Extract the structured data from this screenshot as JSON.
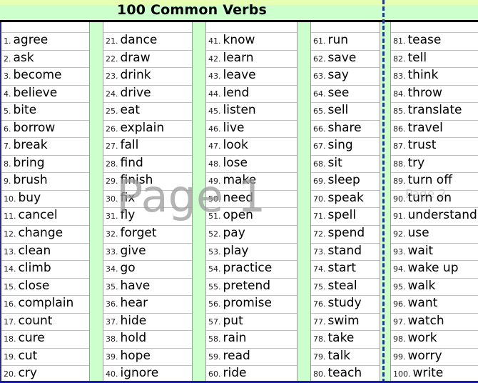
{
  "document": {
    "title": "100 Common Verbs"
  },
  "watermarks": {
    "page1": "Page 1",
    "page2": "Page 2"
  },
  "colors": {
    "title_band": "#ccffcc",
    "title_band_tint": "#e6ffb3",
    "spacer_column": "#ccffcc",
    "grid_line": "#c0c0c0",
    "page_break_line": "#1f3b87",
    "bottom_rule": "#1a1aa8",
    "text": "#000000",
    "watermark": "#9b9b9b"
  },
  "columns": [
    {
      "id": "column-1",
      "range": "1-20",
      "entries": [
        {
          "num": "1.",
          "word": "agree"
        },
        {
          "num": "2.",
          "word": "ask"
        },
        {
          "num": "3.",
          "word": "become"
        },
        {
          "num": "4.",
          "word": "believe"
        },
        {
          "num": "5.",
          "word": "bite"
        },
        {
          "num": "6.",
          "word": "borrow"
        },
        {
          "num": "7.",
          "word": "break"
        },
        {
          "num": "8.",
          "word": "bring"
        },
        {
          "num": "9.",
          "word": "brush"
        },
        {
          "num": "10.",
          "word": "buy"
        },
        {
          "num": "11.",
          "word": "cancel"
        },
        {
          "num": "12.",
          "word": "change"
        },
        {
          "num": "13.",
          "word": "clean"
        },
        {
          "num": "14.",
          "word": "climb"
        },
        {
          "num": "15.",
          "word": "close"
        },
        {
          "num": "16.",
          "word": "complain"
        },
        {
          "num": "17.",
          "word": "count"
        },
        {
          "num": "18.",
          "word": "cure"
        },
        {
          "num": "19.",
          "word": "cut"
        },
        {
          "num": "20.",
          "word": "cry"
        }
      ]
    },
    {
      "id": "column-2",
      "range": "21-40",
      "entries": [
        {
          "num": "21.",
          "word": "dance"
        },
        {
          "num": "22.",
          "word": "draw"
        },
        {
          "num": "23.",
          "word": "drink"
        },
        {
          "num": "24.",
          "word": "drive"
        },
        {
          "num": "25.",
          "word": "eat"
        },
        {
          "num": "26.",
          "word": "explain"
        },
        {
          "num": "27.",
          "word": "fall"
        },
        {
          "num": "28.",
          "word": "find"
        },
        {
          "num": "29.",
          "word": "finish"
        },
        {
          "num": "30.",
          "word": "fix"
        },
        {
          "num": "31.",
          "word": "fly"
        },
        {
          "num": "32.",
          "word": "forget"
        },
        {
          "num": "33.",
          "word": "give"
        },
        {
          "num": "34.",
          "word": "go"
        },
        {
          "num": "35.",
          "word": "have"
        },
        {
          "num": "36.",
          "word": "hear"
        },
        {
          "num": "37.",
          "word": "hide"
        },
        {
          "num": "38.",
          "word": "hold"
        },
        {
          "num": "39.",
          "word": "hope"
        },
        {
          "num": "40.",
          "word": "ignore"
        }
      ]
    },
    {
      "id": "column-3",
      "range": "41-60",
      "entries": [
        {
          "num": "41.",
          "word": "know"
        },
        {
          "num": "42.",
          "word": "learn"
        },
        {
          "num": "43.",
          "word": "leave"
        },
        {
          "num": "44.",
          "word": "lend"
        },
        {
          "num": "45.",
          "word": "listen"
        },
        {
          "num": "46.",
          "word": "live"
        },
        {
          "num": "47.",
          "word": "look"
        },
        {
          "num": "48.",
          "word": "lose"
        },
        {
          "num": "49.",
          "word": "make"
        },
        {
          "num": "50.",
          "word": "need"
        },
        {
          "num": "51.",
          "word": "open"
        },
        {
          "num": "52.",
          "word": "pay"
        },
        {
          "num": "53.",
          "word": "play"
        },
        {
          "num": "54.",
          "word": "practice"
        },
        {
          "num": "55.",
          "word": "pretend"
        },
        {
          "num": "56.",
          "word": "promise"
        },
        {
          "num": "57.",
          "word": "put"
        },
        {
          "num": "58.",
          "word": "rain"
        },
        {
          "num": "59.",
          "word": "read"
        },
        {
          "num": "60.",
          "word": "ride"
        }
      ]
    },
    {
      "id": "column-4",
      "range": "61-80",
      "entries": [
        {
          "num": "61.",
          "word": "run"
        },
        {
          "num": "62.",
          "word": "save"
        },
        {
          "num": "63.",
          "word": "say"
        },
        {
          "num": "64.",
          "word": "see"
        },
        {
          "num": "65.",
          "word": "sell"
        },
        {
          "num": "66.",
          "word": "share"
        },
        {
          "num": "67.",
          "word": "sing"
        },
        {
          "num": "68.",
          "word": "sit"
        },
        {
          "num": "69.",
          "word": "sleep"
        },
        {
          "num": "70.",
          "word": "speak"
        },
        {
          "num": "71.",
          "word": "spell"
        },
        {
          "num": "72.",
          "word": "spend"
        },
        {
          "num": "73.",
          "word": "stand"
        },
        {
          "num": "74.",
          "word": "start"
        },
        {
          "num": "75.",
          "word": "steal"
        },
        {
          "num": "76.",
          "word": "study"
        },
        {
          "num": "77.",
          "word": "swim"
        },
        {
          "num": "78.",
          "word": "take"
        },
        {
          "num": "79.",
          "word": "talk"
        },
        {
          "num": "80.",
          "word": "teach"
        }
      ]
    },
    {
      "id": "column-5",
      "range": "81-100",
      "entries": [
        {
          "num": "81.",
          "word": "tease"
        },
        {
          "num": "82.",
          "word": "tell"
        },
        {
          "num": "83.",
          "word": "think"
        },
        {
          "num": "84.",
          "word": "throw"
        },
        {
          "num": "85.",
          "word": "translate"
        },
        {
          "num": "86.",
          "word": "travel"
        },
        {
          "num": "87.",
          "word": "trust"
        },
        {
          "num": "88.",
          "word": "try"
        },
        {
          "num": "89.",
          "word": "turn off"
        },
        {
          "num": "90.",
          "word": "turn on"
        },
        {
          "num": "91.",
          "word": "understand"
        },
        {
          "num": "92.",
          "word": "use"
        },
        {
          "num": "93.",
          "word": "wait"
        },
        {
          "num": "94.",
          "word": "wake up"
        },
        {
          "num": "95.",
          "word": "walk"
        },
        {
          "num": "96.",
          "word": "want"
        },
        {
          "num": "97.",
          "word": "watch"
        },
        {
          "num": "98.",
          "word": "work"
        },
        {
          "num": "99.",
          "word": "worry"
        },
        {
          "num": "100.",
          "word": "write"
        }
      ]
    }
  ]
}
